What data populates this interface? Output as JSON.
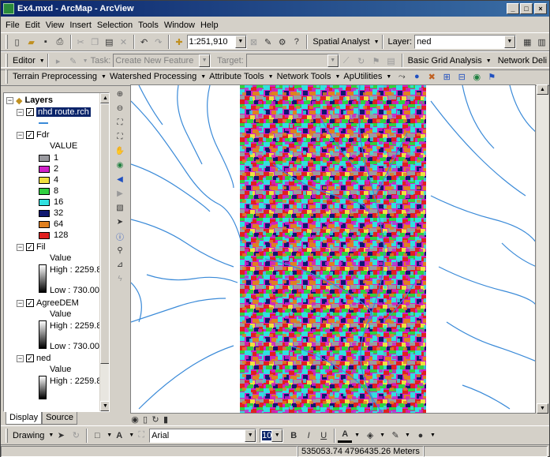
{
  "title": "Ex4.mxd - ArcMap - ArcView",
  "window_buttons": [
    "_",
    "□",
    "×"
  ],
  "menu": [
    "File",
    "Edit",
    "View",
    "Insert",
    "Selection",
    "Tools",
    "Window",
    "Help"
  ],
  "toolbar1": {
    "scale": "1:251,910",
    "spatial_analyst": "Spatial Analyst",
    "layer_label": "Layer:",
    "layer_value": "ned"
  },
  "toolbar2": {
    "editor": "Editor",
    "task_label": "Task:",
    "task_value": "Create New Feature",
    "target_label": "Target:",
    "basic_grid": "Basic Grid Analysis",
    "network_deli": "Network Deli"
  },
  "toolbar3": {
    "terrain": "Terrain Preprocessing",
    "watershed": "Watershed Processing",
    "attribute": "Attribute Tools",
    "network": "Network Tools",
    "aputilities": "ApUtilities"
  },
  "toc": {
    "root": "Layers",
    "layer_nhd": "nhd route.rch",
    "layer_fdr": "Fdr",
    "fdr_field": "VALUE",
    "fdr_classes": [
      {
        "label": "1",
        "color": "#9a9aa0"
      },
      {
        "label": "2",
        "color": "#d020c8"
      },
      {
        "label": "4",
        "color": "#f0e040"
      },
      {
        "label": "8",
        "color": "#30d040"
      },
      {
        "label": "16",
        "color": "#30e0e0"
      },
      {
        "label": "32",
        "color": "#101870"
      },
      {
        "label": "64",
        "color": "#e08020"
      },
      {
        "label": "128",
        "color": "#e02020"
      }
    ],
    "layer_fil": "Fil",
    "fil_value": "Value",
    "fil_high": "High : 2259.8",
    "fil_low": "Low : 730.000",
    "layer_agree": "AgreeDEM",
    "agree_value": "Value",
    "agree_high": "High : 2259.8",
    "agree_low": "Low : 730.000",
    "layer_ned": "ned",
    "ned_value": "Value",
    "ned_high": "High : 2259.8"
  },
  "tabs": [
    "Display",
    "Source"
  ],
  "drawbar": {
    "drawing": "Drawing",
    "font": "Arial",
    "size": "10"
  },
  "status": {
    "coords": "535053.74  4796435.26 Meters"
  },
  "colors": {
    "stream": "#3a8ad8",
    "title_start": "#0a246a",
    "title_end": "#3a6ea5"
  }
}
